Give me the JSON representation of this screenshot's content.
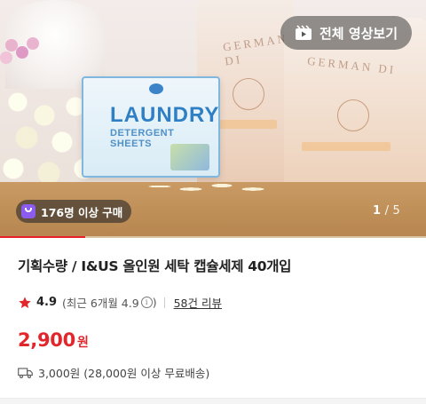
{
  "gallery": {
    "video_button_label": "전체 영상보기",
    "buyers_badge": "176명 이상 구매",
    "current_page": "1",
    "page_divider": "/",
    "total_pages": "5",
    "progress_fraction": 0.2,
    "box_brand": "LAUNDRY",
    "box_subtitle": "DETERGENT SHEETS",
    "pouch_brand": "GERMAN DI"
  },
  "product": {
    "title": "기획수량 / I&US 올인원 세탁 캡슐세제 40개입",
    "rating": {
      "score": "4.9",
      "recent_label": "(최근 6개월 4.9",
      "recent_close": ")",
      "info_icon_glyph": "i",
      "review_link": "58건 리뷰"
    },
    "price": {
      "amount": "2,900",
      "currency": "원"
    },
    "shipping": {
      "text": "3,000원 (28,000원 이상 무료배송)"
    }
  },
  "colors": {
    "accent_red": "#e1262c",
    "star": "#e1262c",
    "badge_purple": "#8c5cf0"
  },
  "icons": {
    "video": "video-play-icon",
    "shopping_bag": "shopping-bag-icon",
    "star": "star-icon",
    "info": "info-icon",
    "truck": "delivery-truck-icon"
  }
}
